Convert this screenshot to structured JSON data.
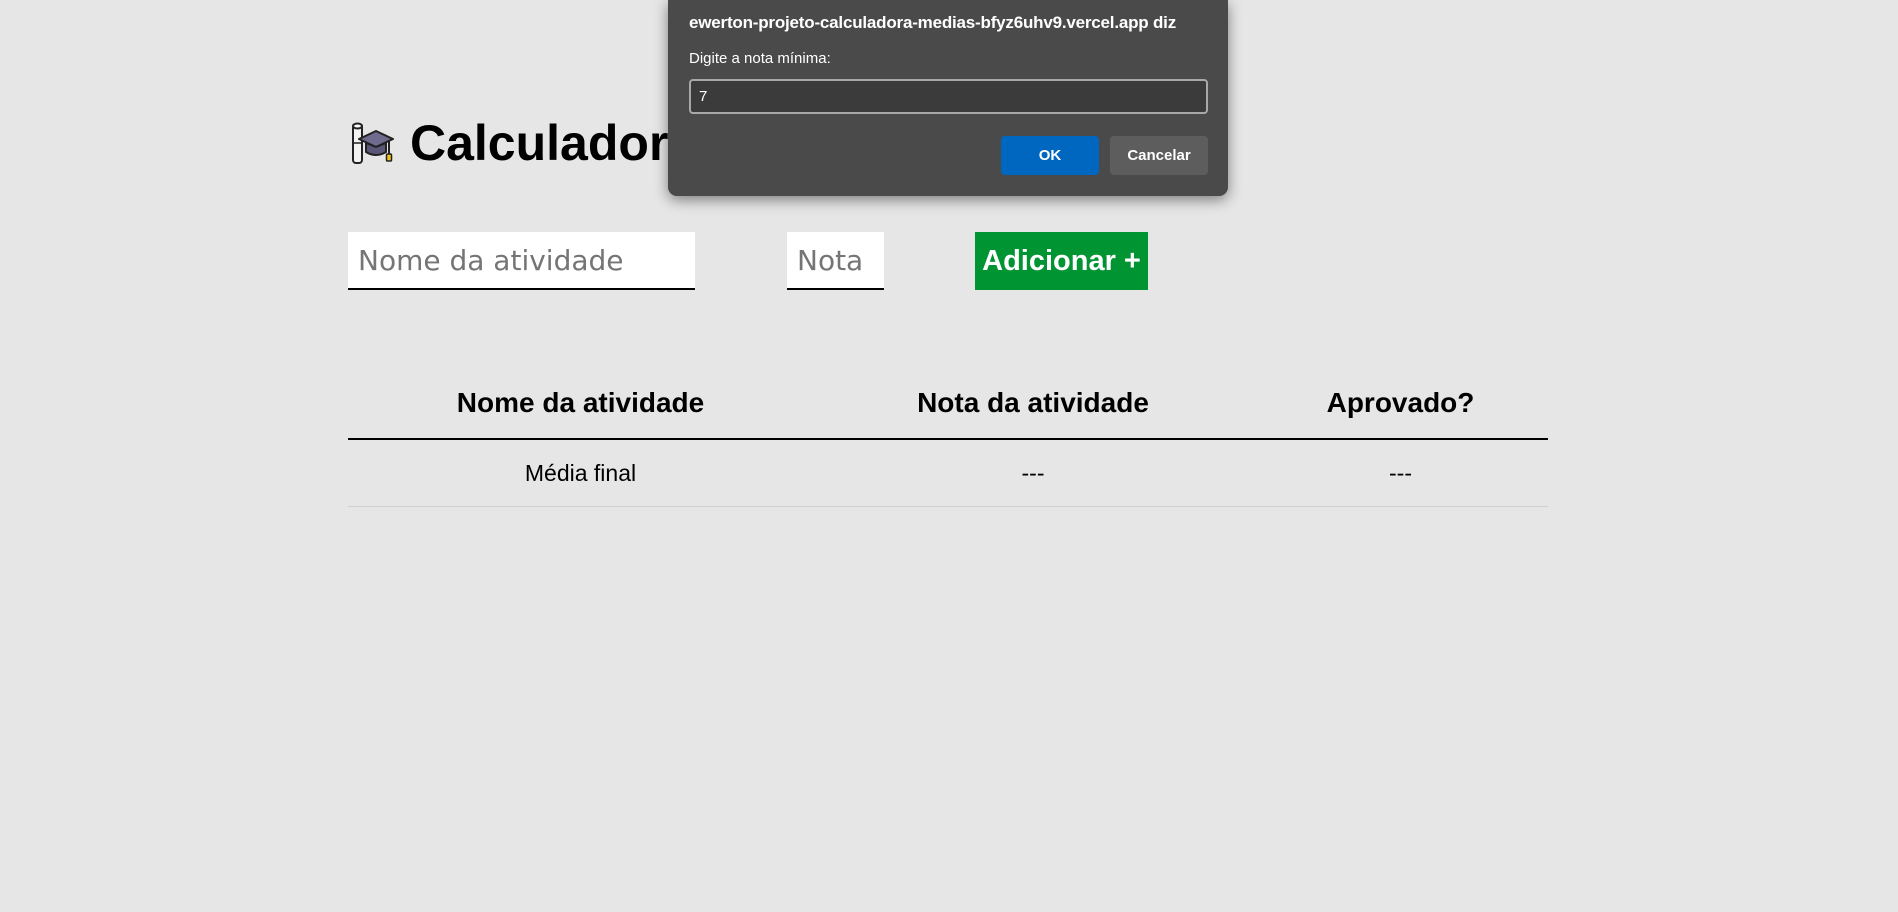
{
  "page": {
    "title": "Calculadora",
    "logo_icon": "graduation-cap-diploma-icon"
  },
  "form": {
    "activity_name_placeholder": "Nome da atividade",
    "activity_name_value": "",
    "grade_placeholder": "Nota",
    "grade_value": "",
    "add_button_label": "Adicionar +"
  },
  "table": {
    "headers": [
      "Nome da atividade",
      "Nota da atividade",
      "Aprovado?"
    ],
    "footer_row": [
      "Média final",
      "---",
      "---"
    ]
  },
  "dialog": {
    "title": "ewerton-projeto-calculadora-medias-bfyz6uhv9.vercel.app diz",
    "message": "Digite a nota mínima:",
    "input_value": "7",
    "ok_label": "OK",
    "cancel_label": "Cancelar"
  },
  "colors": {
    "background": "#e6e6e6",
    "add_button": "#009432",
    "dialog_background": "#4a4a4a",
    "ok_button": "#0067c0",
    "cancel_button": "#5d5d5d"
  }
}
